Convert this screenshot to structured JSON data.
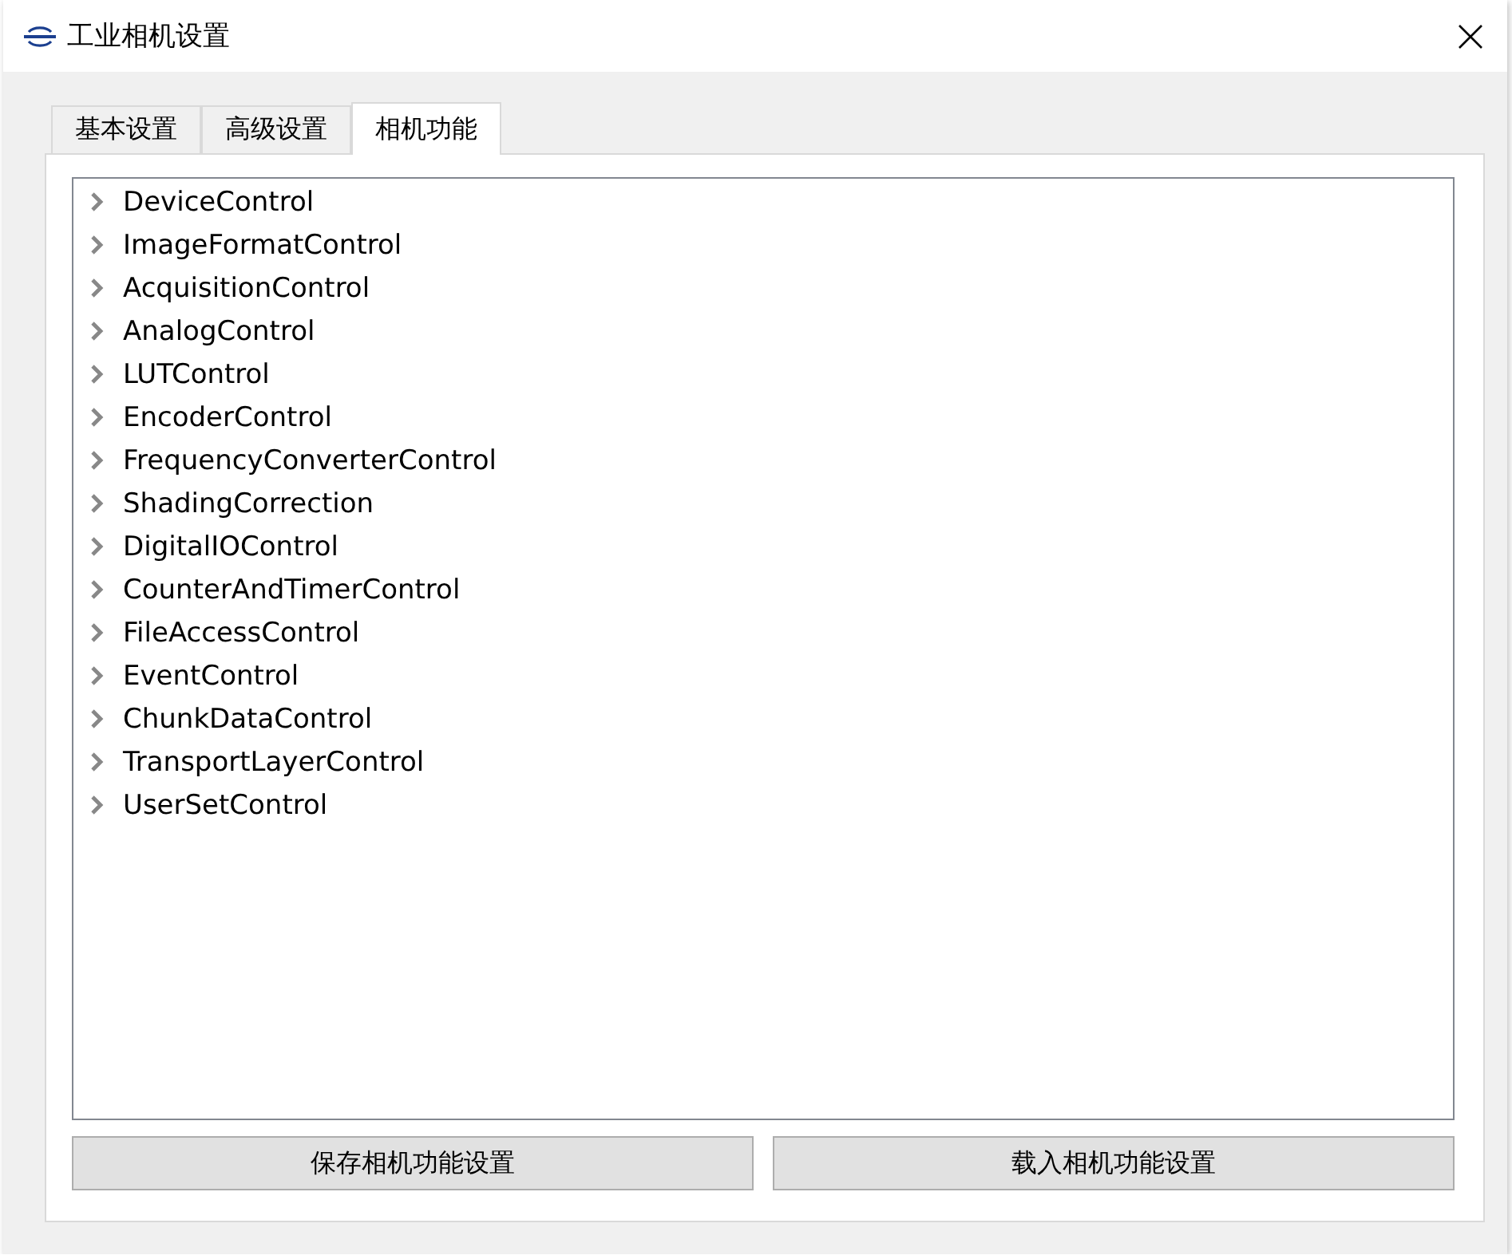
{
  "window": {
    "title": "工业相机设置"
  },
  "tabs": [
    {
      "label": "基本设置",
      "selected": false
    },
    {
      "label": "高级设置",
      "selected": false
    },
    {
      "label": "相机功能",
      "selected": true
    }
  ],
  "tree": {
    "items": [
      {
        "label": "DeviceControl",
        "expanded": false
      },
      {
        "label": "ImageFormatControl",
        "expanded": false
      },
      {
        "label": "AcquisitionControl",
        "expanded": false
      },
      {
        "label": "AnalogControl",
        "expanded": false
      },
      {
        "label": "LUTControl",
        "expanded": false
      },
      {
        "label": "EncoderControl",
        "expanded": false
      },
      {
        "label": "FrequencyConverterControl",
        "expanded": false
      },
      {
        "label": "ShadingCorrection",
        "expanded": false
      },
      {
        "label": "DigitalIOControl",
        "expanded": false
      },
      {
        "label": "CounterAndTimerControl",
        "expanded": false
      },
      {
        "label": "FileAccessControl",
        "expanded": false
      },
      {
        "label": "EventControl",
        "expanded": false
      },
      {
        "label": "ChunkDataControl",
        "expanded": false
      },
      {
        "label": "TransportLayerControl",
        "expanded": false
      },
      {
        "label": "UserSetControl",
        "expanded": false
      }
    ]
  },
  "buttons": [
    {
      "label": "保存相机功能设置"
    },
    {
      "label": "载入相机功能设置"
    }
  ]
}
